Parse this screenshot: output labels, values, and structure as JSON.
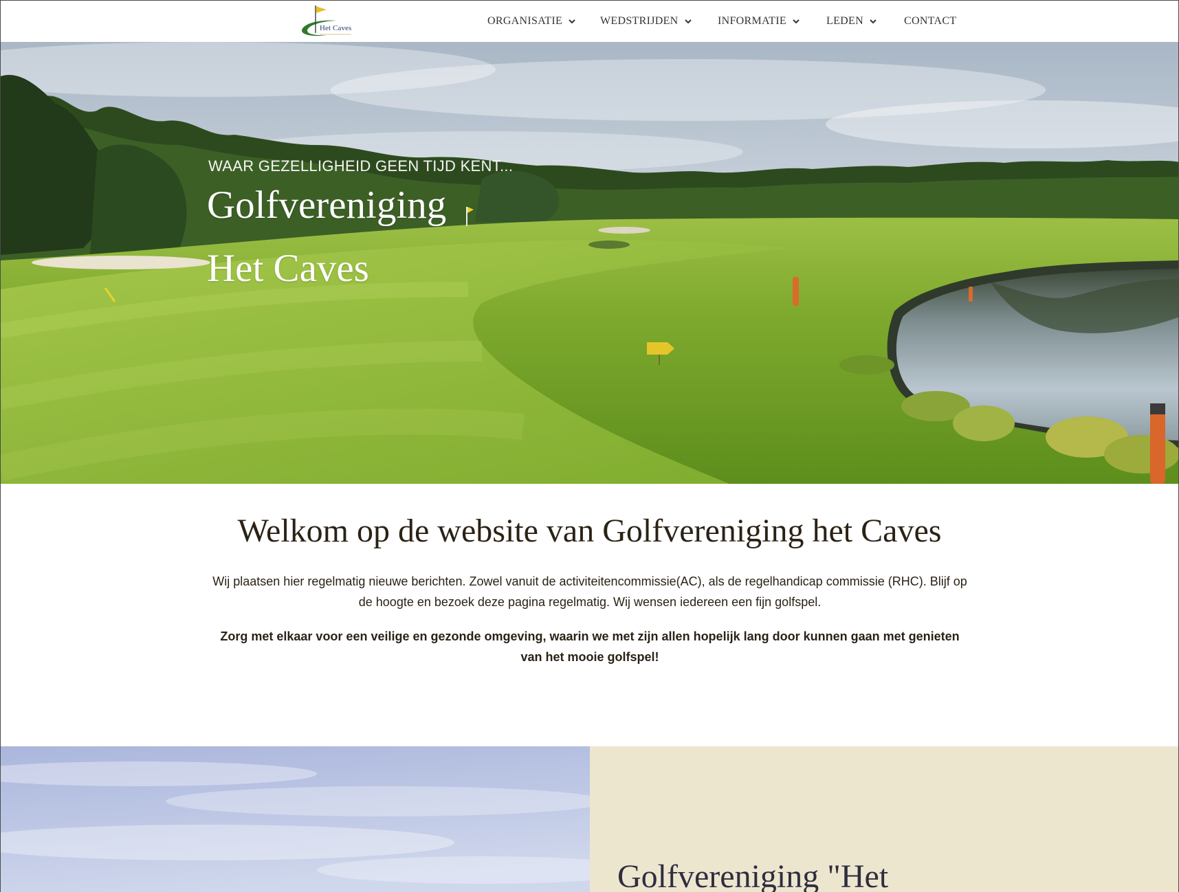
{
  "site": {
    "logo_text": "Het Caves"
  },
  "nav": {
    "items": [
      {
        "label": "ORGANISATIE",
        "has_dropdown": true
      },
      {
        "label": "WEDSTRIJDEN",
        "has_dropdown": true
      },
      {
        "label": "INFORMATIE",
        "has_dropdown": true
      },
      {
        "label": "LEDEN",
        "has_dropdown": true
      },
      {
        "label": "CONTACT",
        "has_dropdown": false
      }
    ]
  },
  "hero": {
    "tagline": "WAAR GEZELLIGHEID GEEN TIJD KENT...",
    "title_line1": "Golfvereniging",
    "title_line2": "Het Caves"
  },
  "welcome": {
    "heading": "Welkom op de website van Golfvereniging het Caves",
    "body": "Wij plaatsen hier regelmatig nieuwe berichten. Zowel vanuit de activiteitencommissie(AC), als de regelhandicap commissie (RHC). Blijf op de hoogte en bezoek deze pagina regelmatig. Wij wensen iedereen een fijn golfspel.",
    "notice": "Zorg met elkaar voor een veilige en gezonde omgeving, waarin we met zijn allen hopelijk lang door kunnen gaan met genieten van het mooie golfspel!"
  },
  "about": {
    "heading": "Golfvereniging \"Het"
  },
  "icons": {
    "dropdown": "chevron-down-icon",
    "logo": "golf-flag-icon"
  },
  "colors": {
    "text_dark": "#2b2216",
    "nav_text": "#333333",
    "panel_beige": "#ede6cf",
    "logo_green": "#2f7a2a",
    "logo_flag": "#e3c12b"
  }
}
